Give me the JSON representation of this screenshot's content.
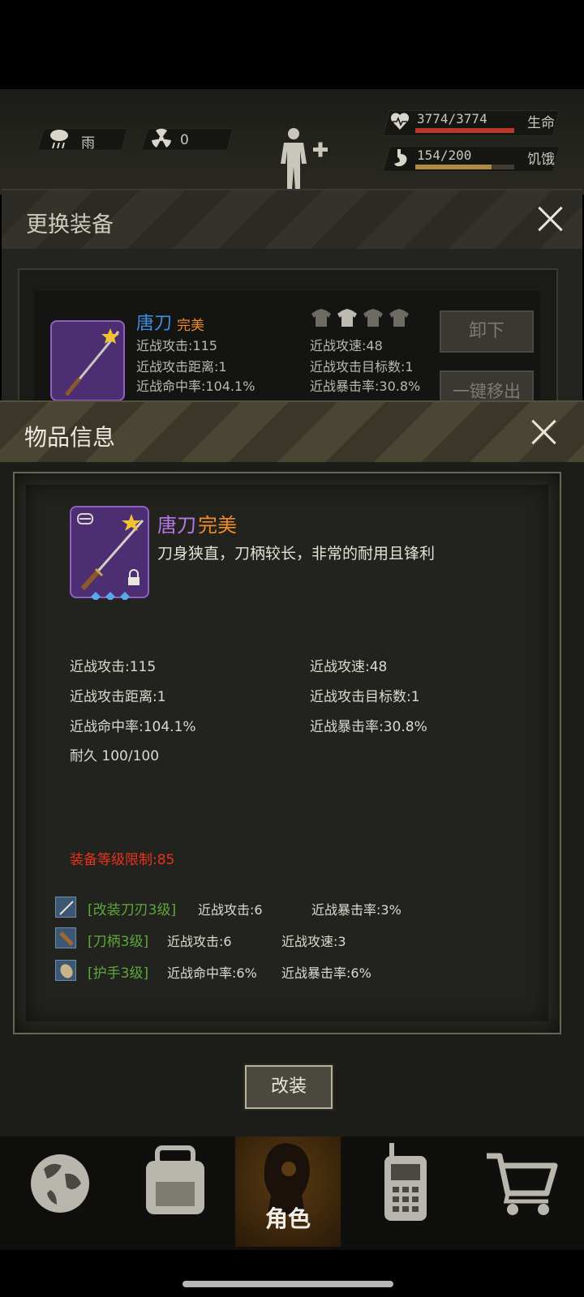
{
  "hud": {
    "weather_label": "雨",
    "radiation_value": "0",
    "health_value": "3774/3774",
    "health_label": "生命",
    "health_level": 1.0,
    "hunger_value": "154/200",
    "hunger_label": "饥饿",
    "hunger_level": 0.77
  },
  "equip_panel": {
    "title": "更换装备",
    "item_name": "唐刀",
    "item_quality": "完美",
    "stats": [
      "近战攻击:115",
      "近战攻速:48",
      "近战攻击距离:1",
      "近战攻击目标数:1",
      "近战命中率:104.1%",
      "近战暴击率:30.8%"
    ],
    "unequip_label": "卸下",
    "remove_all_label": "一键移出"
  },
  "item_info": {
    "title": "物品信息",
    "name": "唐刀",
    "quality": "完美",
    "description": "刀身狭直，刀柄较长，非常的耐用且锋利",
    "stats_left": [
      "近战攻击:115",
      "近战攻击距离:1",
      "近战命中率:104.1%",
      "耐久 100/100"
    ],
    "stats_right": [
      "近战攻速:48",
      "近战攻击目标数:1",
      "近战暴击率:30.8%"
    ],
    "level_requirement": "装备等级限制:85",
    "mods": [
      {
        "name": "[改装刀刃3级]",
        "stat1": "近战攻击:6",
        "stat2": "近战暴击率:3%"
      },
      {
        "name": "[刀柄3级]",
        "stat1": "近战攻击:6",
        "stat2": "近战攻速:3"
      },
      {
        "name": "[护手3级]",
        "stat1": "近战命中率:6%",
        "stat2": "近战暴击率:6%"
      }
    ],
    "modify_button": "改装"
  },
  "nav": {
    "items": [
      {
        "icon": "globe-icon"
      },
      {
        "icon": "backpack-icon"
      },
      {
        "icon": "character-icon",
        "label": "角色"
      },
      {
        "icon": "radio-icon"
      },
      {
        "icon": "cart-icon"
      }
    ]
  },
  "colors": {
    "quality_orange": "#f18a27",
    "name_purple": "#b57ae8",
    "name_blue": "#3d8fe0",
    "requirement_red": "#e8321e",
    "mod_green": "#5ea83a",
    "health_bar": "#b8392c",
    "hunger_bar": "#b08a3c"
  }
}
